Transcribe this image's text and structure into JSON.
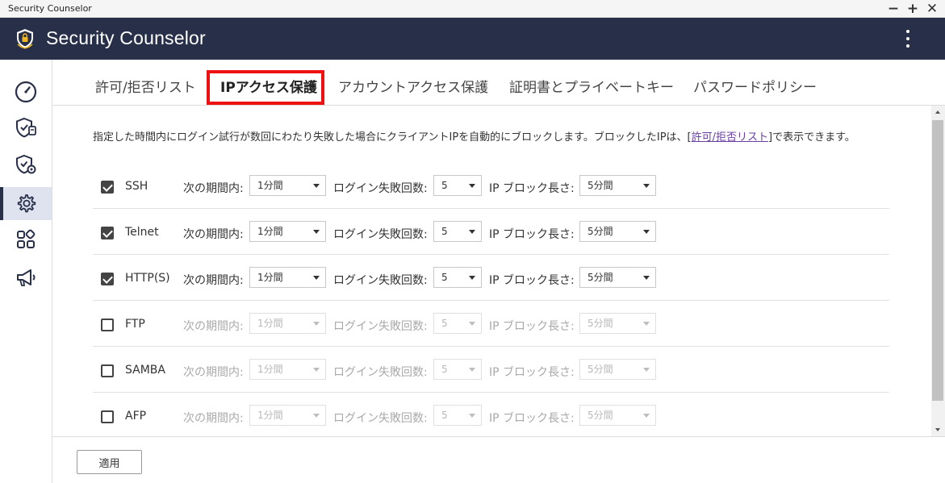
{
  "window": {
    "title": "Security Counselor",
    "controls": [
      "−",
      "+",
      "✕"
    ]
  },
  "header": {
    "app_title": "Security Counselor",
    "logo_icon": "shield-lock-icon",
    "menu_icon": "kebab-menu-icon"
  },
  "sidebar": {
    "items": [
      {
        "icon": "dashboard-gauge-icon",
        "active": false
      },
      {
        "icon": "shield-scan-icon",
        "active": false
      },
      {
        "icon": "shield-settings-icon",
        "active": false
      },
      {
        "icon": "gear-icon",
        "active": true
      },
      {
        "icon": "apps-grid-icon",
        "active": false
      },
      {
        "icon": "megaphone-icon",
        "active": false
      }
    ]
  },
  "tabs": [
    {
      "label": "許可/拒否リスト",
      "active": false
    },
    {
      "label": "IPアクセス保護",
      "active": true
    },
    {
      "label": "アカウントアクセス保護",
      "active": false
    },
    {
      "label": "証明書とプライベートキー",
      "active": false
    },
    {
      "label": "パスワードポリシー",
      "active": false
    }
  ],
  "description": {
    "before": "指定した時間内にログイン試行が数回にわたり失敗した場合にクライアントIPを自動的にブロックします。ブロックしたIPは、[",
    "link": "許可/拒否リスト",
    "after": "]で表示できます。"
  },
  "labels": {
    "period": "次の期間内:",
    "failures": "ログイン失敗回数:",
    "block": "IP ブロック長さ:"
  },
  "rows": [
    {
      "protocol": "SSH",
      "checked": true,
      "period": "1分間",
      "failures": "5",
      "block": "5分間"
    },
    {
      "protocol": "Telnet",
      "checked": true,
      "period": "1分間",
      "failures": "5",
      "block": "5分間"
    },
    {
      "protocol": "HTTP(S)",
      "checked": true,
      "period": "1分間",
      "failures": "5",
      "block": "5分間"
    },
    {
      "protocol": "FTP",
      "checked": false,
      "period": "1分間",
      "failures": "5",
      "block": "5分間"
    },
    {
      "protocol": "SAMBA",
      "checked": false,
      "period": "1分間",
      "failures": "5",
      "block": "5分間"
    },
    {
      "protocol": "AFP",
      "checked": false,
      "period": "1分間",
      "failures": "5",
      "block": "5分間"
    }
  ],
  "footer": {
    "apply_label": "適用"
  },
  "colors": {
    "header_bg": "#283049",
    "highlight": "#ee1111",
    "link": "#6a3fa3"
  }
}
